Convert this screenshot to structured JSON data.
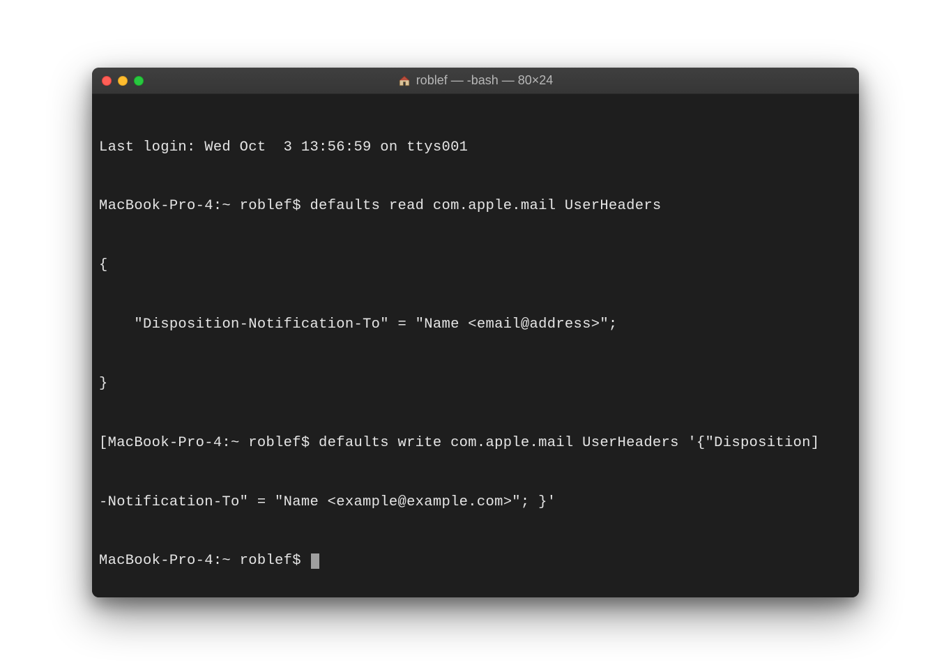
{
  "window": {
    "title": "roblef — -bash — 80×24",
    "icon": "home-icon",
    "traffic_lights": {
      "close": "#ff5f57",
      "minimize": "#febc2e",
      "zoom": "#28c840"
    }
  },
  "terminal": {
    "lines": [
      "Last login: Wed Oct  3 13:56:59 on ttys001",
      "MacBook-Pro-4:~ roblef$ defaults read com.apple.mail UserHeaders",
      "{",
      "    \"Disposition-Notification-To\" = \"Name <email@address>\";",
      "}",
      "[MacBook-Pro-4:~ roblef$ defaults write com.apple.mail UserHeaders '{\"Disposition]",
      "-Notification-To\" = \"Name <example@example.com>\"; }'",
      "MacBook-Pro-4:~ roblef$ "
    ],
    "prompt": "MacBook-Pro-4:~ roblef$",
    "last_login": "Wed Oct  3 13:56:59 on ttys001",
    "commands": [
      "defaults read com.apple.mail UserHeaders",
      "defaults write com.apple.mail UserHeaders '{\"Disposition-Notification-To\" = \"Name <example@example.com>\"; }'"
    ],
    "output_read": "{\n    \"Disposition-Notification-To\" = \"Name <email@address>\";\n}"
  },
  "colors": {
    "bg": "#1e1e1e",
    "fg": "#e5e5e5",
    "titlebar_text": "#b7b7b7"
  }
}
